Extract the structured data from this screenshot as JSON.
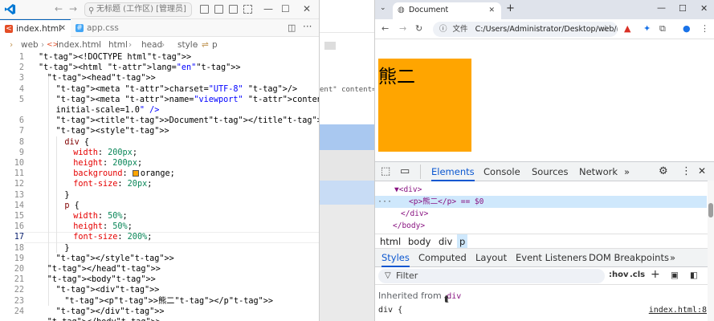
{
  "vscode": {
    "title": "无标题 (工作区) [管理员]",
    "tabs": [
      {
        "label": "index.html",
        "icon_name": "html-file-icon"
      },
      {
        "label": "app.css",
        "icon_name": "css-file-icon"
      }
    ],
    "breadcrumb": [
      "web",
      "index.html",
      "html",
      "head",
      "style",
      "p"
    ],
    "line_numbers": [
      "1",
      "2",
      "3",
      "4",
      "5",
      "",
      "6",
      "7",
      "8",
      "9",
      "10",
      "11",
      "12",
      "13",
      "14",
      "15",
      "16",
      "17",
      "18",
      "19",
      "20",
      "21",
      "22",
      "23",
      "24",
      ""
    ],
    "current_line": "17",
    "code": [
      "<!DOCTYPE html>",
      "<html lang=\"en\">",
      "<head>",
      "<meta charset=\"UTF-8\" />",
      "<meta name=\"viewport\" content=\"width=device-width,",
      "initial-scale=1.0\" />",
      "<title>Document</title>",
      "<style>",
      "div {",
      "width: 200px;",
      "height: 200px;",
      "background: orange;",
      "font-size: 20px;",
      "}",
      "p {",
      "width: 50%;",
      "height: 50%;",
      "font-size: 200%;",
      "}",
      "</style>",
      "</head>",
      "<body>",
      "<div>",
      "<p>熊二</p>",
      "</div>",
      "</body>"
    ],
    "accent": "#005fb8"
  },
  "middle_strip": {
    "visible_text": "ent\" content=\"width=devic"
  },
  "chrome": {
    "tab_title": "Document",
    "url_scheme_label": "文件",
    "url": "C:/Users/Administrator/Desktop/web/in...",
    "page_text": "熊二",
    "page_colors": {
      "div_background": "#ffa500"
    },
    "devtools": {
      "tabs": [
        "Elements",
        "Console",
        "Sources",
        "Network"
      ],
      "active_tab": "Elements",
      "dom": [
        "▼<div>",
        "<p>熊二</p> == $0",
        "</div>",
        "</body>"
      ],
      "crumbs": [
        "html",
        "body",
        "div",
        "p"
      ],
      "sub_tabs": [
        "Styles",
        "Computed",
        "Layout",
        "Event Listeners",
        "DOM Breakpoints"
      ],
      "filter_placeholder": "Filter",
      "hov_label": ":hov",
      "cls_label": ".cls",
      "inherited_label": "Inherited from",
      "inherited_from": "div",
      "rule_selector": "div {",
      "rule_source": "index.html:8",
      "accent": "#0b57d0"
    }
  }
}
